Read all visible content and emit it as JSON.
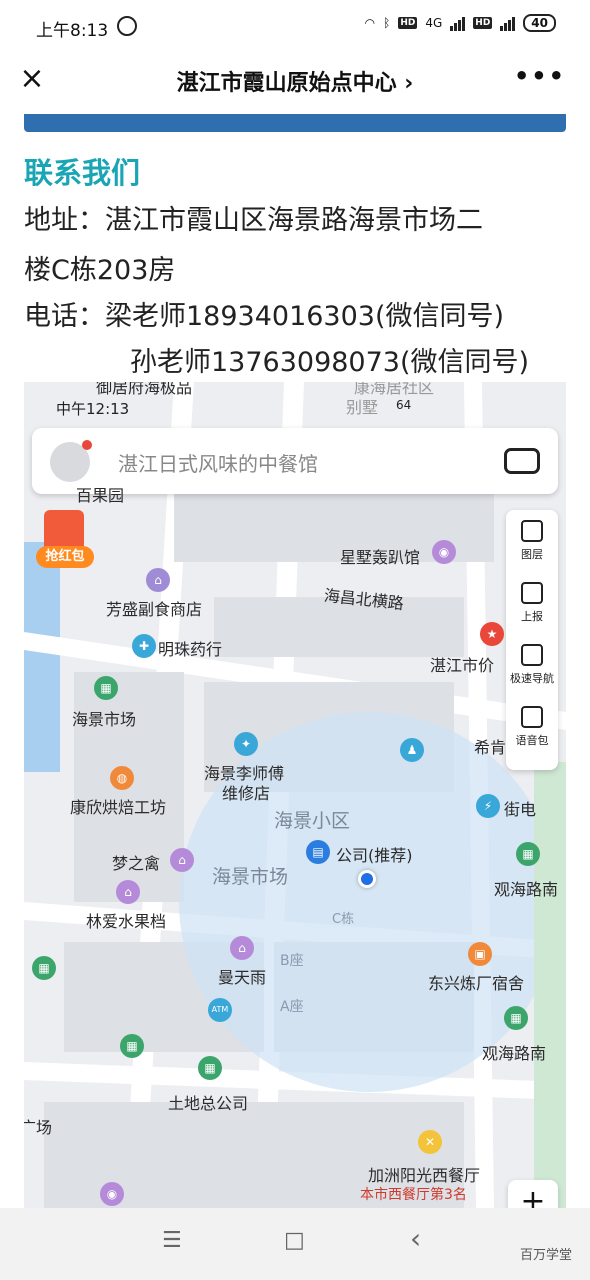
{
  "status": {
    "time": "上午8:13",
    "network": "4G",
    "battery": "40"
  },
  "nav": {
    "close": "×",
    "title": "湛江市霞山原始点中心 ›",
    "more": "•••"
  },
  "contact": {
    "heading": "联系我们",
    "address_line1": "地址：湛江市霞山区海景路海景市场二",
    "address_line2": "楼C栋203房",
    "phone_line1": "电话：梁老师18934016303(微信同号)",
    "phone_line2": "孙老师13763098073(微信同号)"
  },
  "map": {
    "status_time": "中午12:13",
    "battery": "64",
    "search_placeholder": "湛江日式风味的中餐馆",
    "red_packet": "抢红包",
    "tools": [
      "图层",
      "上报",
      "极速导航",
      "语音包"
    ],
    "zoom_in": "+",
    "pois": {
      "top_left": "御居府海极品",
      "top_right1": "康海居社区",
      "top_right2": "别墅",
      "baiguoyuan": "百果园",
      "xingshu": "星墅轰趴馆",
      "haichang": "海昌北横路",
      "fangsheng": "芳盛副食商店",
      "mingzhu": "明珠药行",
      "zhanjiang": "湛江市价",
      "haijing_market": "海景市场",
      "xiken": "希肯",
      "li_master1": "海景李师傅",
      "li_master2": "维修店",
      "kangxin": "康欣烘焙工坊",
      "haijing_district": "海景小区",
      "jiedian": "街电",
      "mengzhiqin": "梦之禽",
      "company": "公司(推荐)",
      "guanhai1": "观海路南",
      "haijing_market_big": "海景市场",
      "c_building": "C栋",
      "linai": "林爱水果档",
      "mantianyu": "曼天雨",
      "b_building": "B座",
      "dongxing": "东兴炼厂宿舍",
      "a_building": "A座",
      "guanhai2": "观海路南",
      "atm": "ATM",
      "land": "土地总公司",
      "square": "广场",
      "jiazhou": "加洲阳光西餐厅",
      "rank": "本市西餐厅第3名"
    }
  },
  "bottom": {
    "menu": "☰",
    "home": "□",
    "back": "‹",
    "watermark": "百万学堂"
  }
}
